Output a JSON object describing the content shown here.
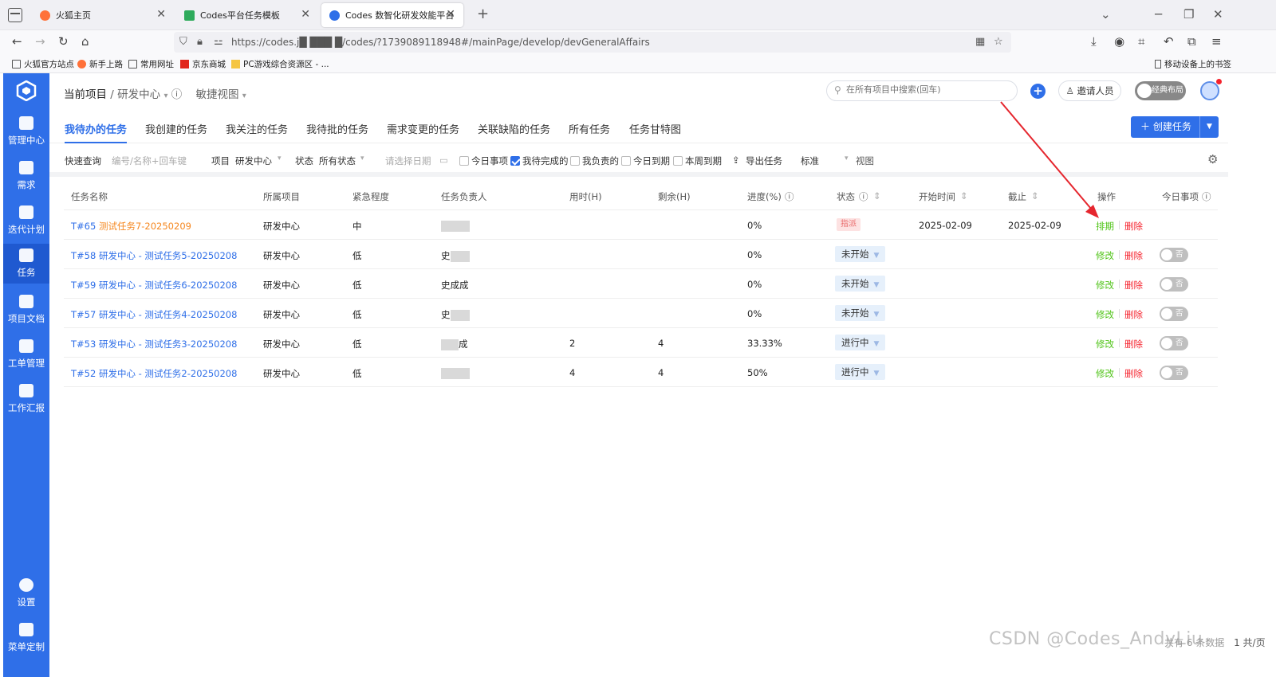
{
  "browser": {
    "tabs": [
      {
        "title": "火狐主页",
        "color": "#ff7139"
      },
      {
        "title": "Codes平台任务模板",
        "color": "#2eaa5b"
      },
      {
        "title": "Codes 数智化研发效能平台",
        "color": "#2f6fe8"
      }
    ],
    "url": "https://codes.j█ ███ █/codes/?1739089118948#/mainPage/develop/devGeneralAffairs",
    "bookmarks": [
      "火狐官方站点",
      "新手上路",
      "常用网址",
      "京东商城",
      "PC游戏综合资源区 - ..."
    ],
    "mobile_bookmarks": "移动设备上的书签"
  },
  "sidebar": {
    "items": [
      {
        "label": "管理中心"
      },
      {
        "label": "需求"
      },
      {
        "label": "迭代计划"
      },
      {
        "label": "任务"
      },
      {
        "label": "项目文档"
      },
      {
        "label": "工单管理"
      },
      {
        "label": "工作汇报"
      },
      {
        "label": "设置"
      },
      {
        "label": "菜单定制"
      }
    ]
  },
  "header": {
    "crumb_current": "当前项目",
    "crumb_sep": "/",
    "crumb_project": "研发中心",
    "agile_view": "敏捷视图",
    "search_placeholder": "在所有项目中搜索(回车)",
    "invite": "邀请人员",
    "classic_layout": "经典布局"
  },
  "tabs": [
    {
      "label": "我待办的任务"
    },
    {
      "label": "我创建的任务"
    },
    {
      "label": "我关注的任务"
    },
    {
      "label": "我待批的任务"
    },
    {
      "label": "需求变更的任务"
    },
    {
      "label": "关联缺陷的任务"
    },
    {
      "label": "所有任务"
    },
    {
      "label": "任务甘特图"
    }
  ],
  "create_task": "创建任务",
  "filters": {
    "quick_query": "快速查询",
    "quick_placeholder": "编号/名称+回车键",
    "project_label": "项目",
    "project_value": "研发中心",
    "status_label": "状态",
    "status_value": "所有状态",
    "date_placeholder": "请选择日期",
    "checks": [
      {
        "label": "今日事项",
        "checked": false
      },
      {
        "label": "我待完成的",
        "checked": true
      },
      {
        "label": "我负责的",
        "checked": false
      },
      {
        "label": "今日到期",
        "checked": false
      },
      {
        "label": "本周到期",
        "checked": false
      }
    ],
    "export": "导出任务",
    "standard": "标准",
    "view": "视图"
  },
  "table": {
    "columns": [
      "任务名称",
      "所属项目",
      "紧急程度",
      "任务负责人",
      "用时(H)",
      "剩余(H)",
      "进度(%)",
      "状态",
      "开始时间",
      "截止",
      "操作",
      "今日事项"
    ],
    "rows": [
      {
        "id": "T#65",
        "name": "测试任务7-20250209",
        "project": "研发中心",
        "urgency": "中",
        "owner": "",
        "used": "",
        "remain": "",
        "progress": "0%",
        "status": "指派",
        "start": "2025-02-09",
        "end": "2025-02-09",
        "op1": "排期",
        "op2": "删除",
        "today": ""
      },
      {
        "id": "T#58",
        "name": "研发中心 - 测试任务5-20250208",
        "project": "研发中心",
        "urgency": "低",
        "owner": "史",
        "used": "",
        "remain": "",
        "progress": "0%",
        "status": "未开始",
        "start": "",
        "end": "",
        "op1": "修改",
        "op2": "删除",
        "today": "否"
      },
      {
        "id": "T#59",
        "name": "研发中心 - 测试任务6-20250208",
        "project": "研发中心",
        "urgency": "低",
        "owner": "史成成",
        "used": "",
        "remain": "",
        "progress": "0%",
        "status": "未开始",
        "start": "",
        "end": "",
        "op1": "修改",
        "op2": "删除",
        "today": "否"
      },
      {
        "id": "T#57",
        "name": "研发中心 - 测试任务4-20250208",
        "project": "研发中心",
        "urgency": "低",
        "owner": "史",
        "used": "",
        "remain": "",
        "progress": "0%",
        "status": "未开始",
        "start": "",
        "end": "",
        "op1": "修改",
        "op2": "删除",
        "today": "否"
      },
      {
        "id": "T#53",
        "name": "研发中心 - 测试任务3-20250208",
        "project": "研发中心",
        "urgency": "低",
        "owner": "成",
        "used": "2",
        "remain": "4",
        "progress": "33.33%",
        "status": "进行中",
        "start": "",
        "end": "",
        "op1": "修改",
        "op2": "删除",
        "today": "否"
      },
      {
        "id": "T#52",
        "name": "研发中心 - 测试任务2-20250208",
        "project": "研发中心",
        "urgency": "低",
        "owner": "",
        "used": "4",
        "remain": "4",
        "progress": "50%",
        "status": "进行中",
        "start": "",
        "end": "",
        "op1": "修改",
        "op2": "删除",
        "today": "否"
      }
    ]
  },
  "footer": {
    "watermark": "CSDN @Codes_AndyLiu",
    "total": "共有 6 条数据",
    "pages": "1 共/页"
  },
  "colors": {
    "accent": "#2f6fe8",
    "edit": "#52c41a",
    "delete": "#f5222d",
    "task_title_orange": "#f5871f",
    "annotation": "#e5262e"
  }
}
